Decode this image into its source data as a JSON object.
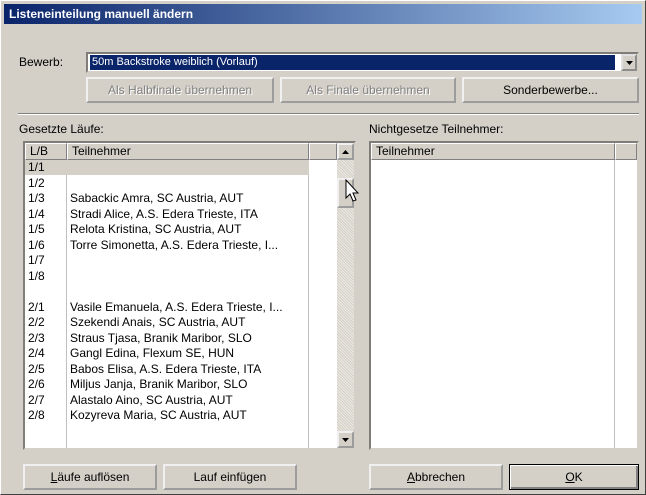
{
  "window": {
    "title": "Listeneinteilung manuell ändern"
  },
  "bewerb": {
    "label": "Bewerb:",
    "value": "50m Backstroke weiblich (Vorlauf)"
  },
  "buttons": {
    "halbfinale": "Als Halbfinale übernehmen",
    "finale": "Als Finale übernehmen",
    "sonder": "Sonderbewerbe...",
    "aufloesen_pre": "L",
    "aufloesen_rest": "äufe auflösen",
    "einfuegen": "Lauf einfügen",
    "abbrechen_pre": "A",
    "abbrechen_rest": "bbrechen",
    "ok_pre": "O",
    "ok_rest": "K"
  },
  "left_panel": {
    "title": "Gesetzte Läufe:",
    "col_lb": "L/B",
    "col_teilnehmer": "Teilnehmer",
    "rows": [
      {
        "lb": "1/1",
        "name": ""
      },
      {
        "lb": "1/2",
        "name": ""
      },
      {
        "lb": "1/3",
        "name": "Sabackic Amra, SC Austria, AUT"
      },
      {
        "lb": "1/4",
        "name": "Stradi Alice, A.S. Edera Trieste, ITA"
      },
      {
        "lb": "1/5",
        "name": "Relota Kristina, SC Austria, AUT"
      },
      {
        "lb": "1/6",
        "name": "Torre Simonetta, A.S. Edera Trieste, I..."
      },
      {
        "lb": "1/7",
        "name": ""
      },
      {
        "lb": "1/8",
        "name": ""
      },
      {
        "lb": "",
        "name": ""
      },
      {
        "lb": "2/1",
        "name": "Vasile Emanuela, A.S. Edera Trieste, I..."
      },
      {
        "lb": "2/2",
        "name": "Szekendi Anais, SC Austria, AUT"
      },
      {
        "lb": "2/3",
        "name": "Straus Tjasa, Branik Maribor, SLO"
      },
      {
        "lb": "2/4",
        "name": "Gangl Edina, Flexum SE, HUN"
      },
      {
        "lb": "2/5",
        "name": "Babos Elisa, A.S. Edera Trieste, ITA"
      },
      {
        "lb": "2/6",
        "name": "Miljus Janja, Branik Maribor, SLO"
      },
      {
        "lb": "2/7",
        "name": "Alastalo Aino, SC Austria, AUT"
      },
      {
        "lb": "2/8",
        "name": "Kozyreva Maria, SC Austria, AUT"
      }
    ]
  },
  "right_panel": {
    "title": "Nichtgesetze Teilnehmer:",
    "col_teilnehmer": "Teilnehmer"
  }
}
